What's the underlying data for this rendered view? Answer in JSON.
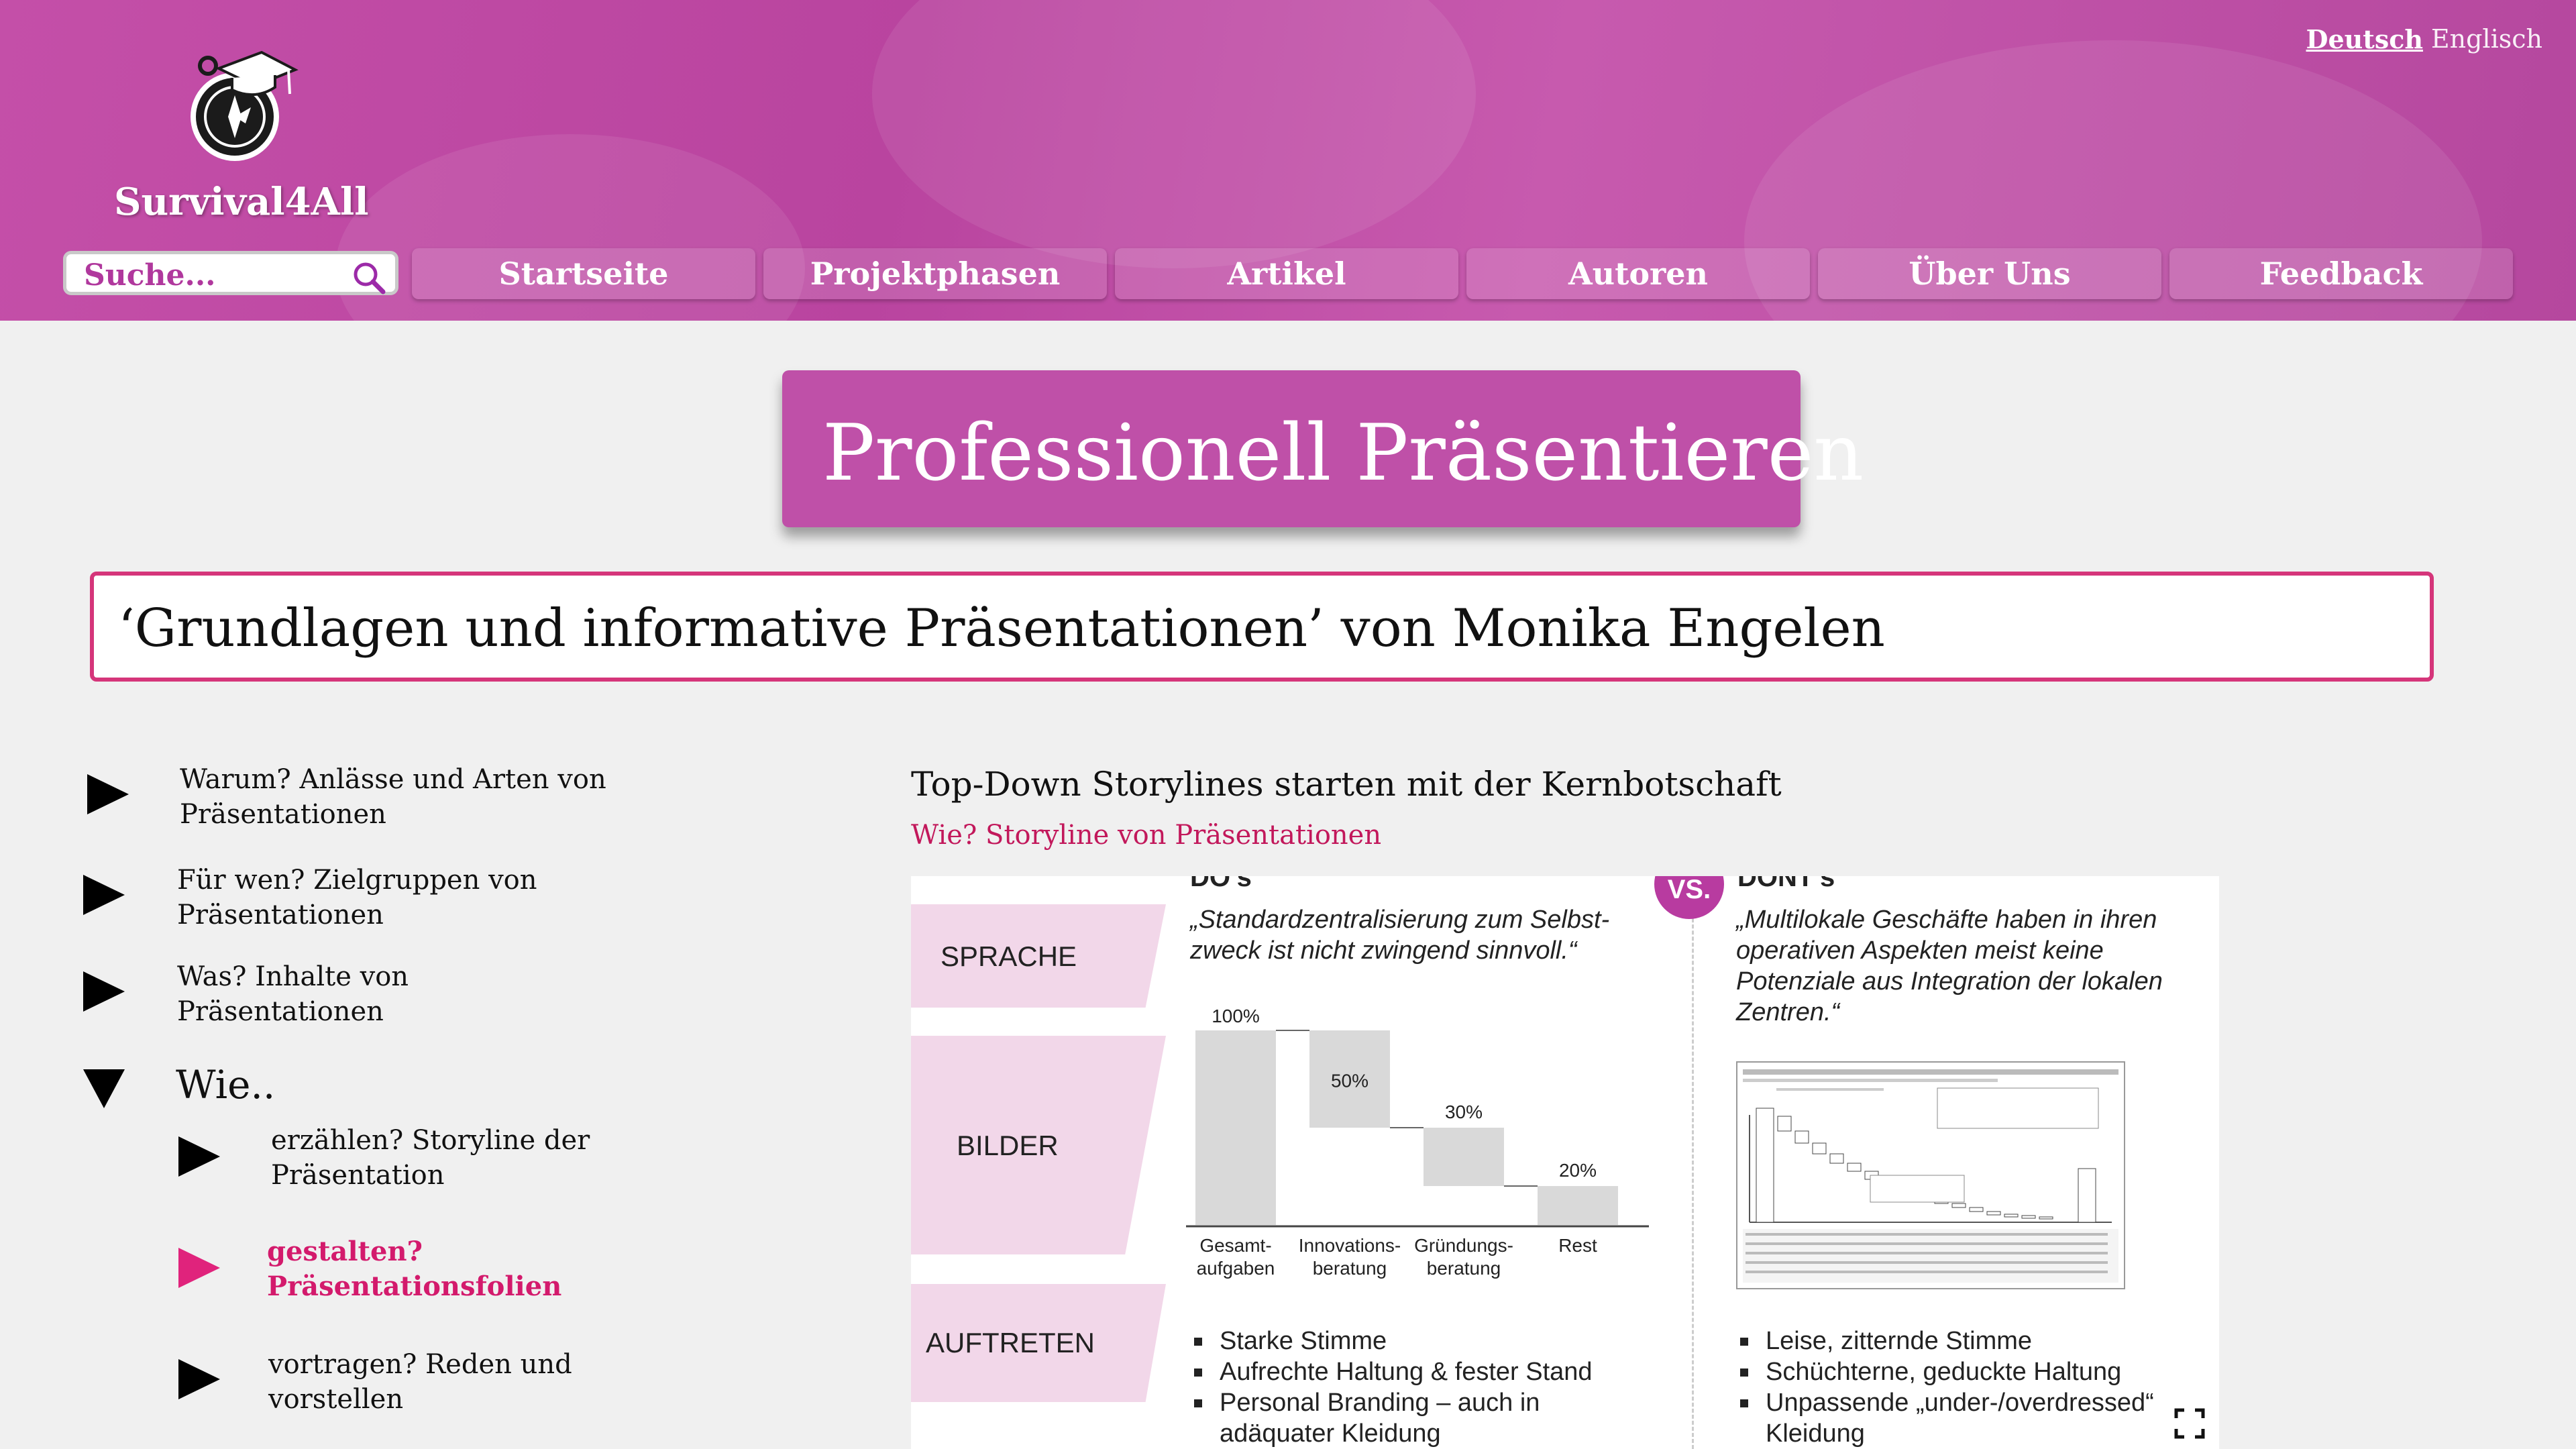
{
  "header": {
    "brand": "Survival4All",
    "languages": {
      "active": "Deutsch",
      "other": "Englisch"
    }
  },
  "search": {
    "placeholder": "Suche..."
  },
  "nav": [
    "Startseite",
    "Projektphasen",
    "Artikel",
    "Autoren",
    "Über Uns",
    "Feedback"
  ],
  "page": {
    "title": "Professionell Präsentieren",
    "subtitle": "‘Grundlagen und informative Präsentationen’ von Monika Engelen"
  },
  "sidebar": {
    "items": [
      {
        "label": "Warum? Anlässe und Arten von Präsentationen"
      },
      {
        "label": "Für wen? Zielgruppen von Präsentationen"
      },
      {
        "label": "Was? Inhalte von Präsentationen"
      },
      {
        "label": "Wie.."
      }
    ],
    "subitems": [
      {
        "label": "erzählen? Storyline der Präsentation"
      },
      {
        "label": "gestalten? Präsentationsfolien"
      },
      {
        "label": "vortragen? Reden und vorstellen"
      }
    ]
  },
  "content": {
    "heading": "Top-Down Storylines starten mit der Kernbotschaft",
    "link": "Wie? Storyline von Präsentationen"
  },
  "slide": {
    "dos_title": "DO’s",
    "donts_title": "DONT’s",
    "vs": "VS.",
    "rows": [
      "SPRACHE",
      "BILDER",
      "AUFTRETEN"
    ],
    "quote_do": "„Standardzentralisierung zum Selbst-zweck ist nicht zwingend sinnvoll.“",
    "quote_dont": "„Multilokale Geschäfte haben in ihren operativen Aspekten meist keine Potenziale aus Integration der lokalen Zentren.“",
    "bullets_do": [
      "Starke Stimme",
      "Aufrechte Haltung & fester Stand",
      "Personal Branding – auch in adäquater Kleidung"
    ],
    "bullets_dont": [
      "Leise, zitternde Stimme",
      "Schüchterne, geduckte Haltung",
      "Unpassende „under-/overdressed“ Kleidung"
    ]
  },
  "chart_data": {
    "type": "bar",
    "categories": [
      "Gesamt-\naufgaben",
      "Innovations-\nberatung",
      "Gründungs-\nberatung",
      "Rest"
    ],
    "values": [
      100,
      50,
      30,
      20
    ],
    "value_labels": [
      "100%",
      "50%",
      "30%",
      "20%"
    ],
    "style": "waterfall"
  }
}
